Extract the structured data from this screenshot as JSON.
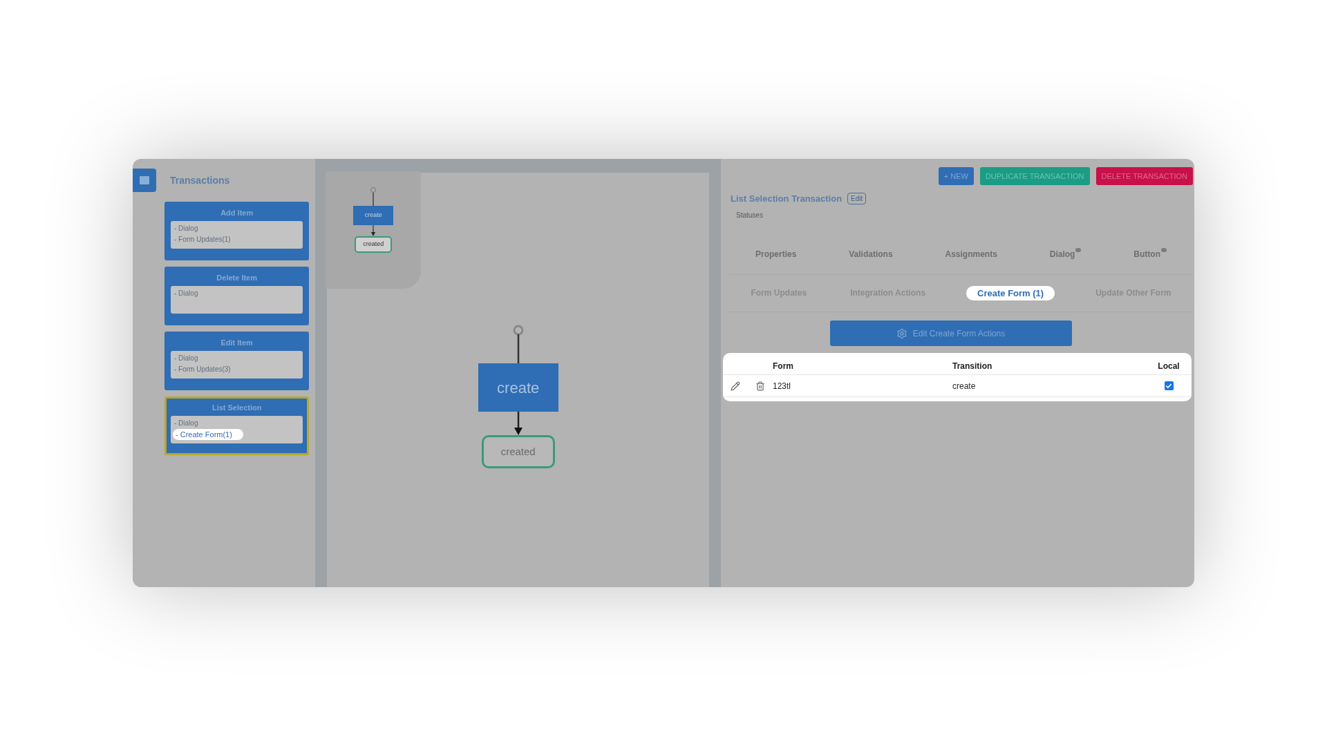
{
  "sidebar": {
    "title": "Transactions",
    "cards": [
      {
        "title": "Add Item",
        "selected": false,
        "lines": [
          {
            "text": "- Dialog",
            "highlighted": false
          },
          {
            "text": "- Form Updates(1)",
            "highlighted": false
          }
        ]
      },
      {
        "title": "Delete Item",
        "selected": false,
        "lines": [
          {
            "text": "- Dialog",
            "highlighted": false
          }
        ]
      },
      {
        "title": "Edit Item",
        "selected": false,
        "lines": [
          {
            "text": "- Dialog",
            "highlighted": false
          },
          {
            "text": "- Form Updates(3)",
            "highlighted": false
          }
        ]
      },
      {
        "title": "List Selection",
        "selected": true,
        "lines": [
          {
            "text": "- Dialog",
            "highlighted": false
          },
          {
            "text": "- Create Form(1)",
            "highlighted": true
          }
        ]
      }
    ]
  },
  "canvas": {
    "minimap_nodes": [
      {
        "label": "create",
        "kind": "action"
      },
      {
        "label": "created",
        "kind": "state"
      }
    ],
    "nodes": [
      {
        "label": "create",
        "kind": "action"
      },
      {
        "label": "created",
        "kind": "state"
      }
    ]
  },
  "toolbar": [
    {
      "label": "+ NEW",
      "kind": "new"
    },
    {
      "label": "DUPLICATE TRANSACTION",
      "kind": "duplicate"
    },
    {
      "label": "DELETE TRANSACTION",
      "kind": "delete"
    }
  ],
  "transaction": {
    "title": "List Selection Transaction",
    "edit_label": "Edit",
    "subtitle": "Statuses"
  },
  "tabs_primary": [
    {
      "label": "Properties",
      "badge": false
    },
    {
      "label": "Validations",
      "badge": false
    },
    {
      "label": "Assignments",
      "badge": false
    },
    {
      "label": "Dialog",
      "badge": true
    },
    {
      "label": "Button",
      "badge": true
    }
  ],
  "tabs_secondary": [
    {
      "label": "Form Updates",
      "selected": false
    },
    {
      "label": "Integration Actions",
      "selected": false
    },
    {
      "label": "Create Form (1)",
      "selected": true
    },
    {
      "label": "Update Other Form",
      "selected": false
    }
  ],
  "action_button": {
    "label": "Edit Create Form Actions"
  },
  "table": {
    "columns": [
      "Form",
      "Transition",
      "Local"
    ],
    "rows": [
      {
        "form": "123tl",
        "transition": "create",
        "local": true
      }
    ]
  }
}
